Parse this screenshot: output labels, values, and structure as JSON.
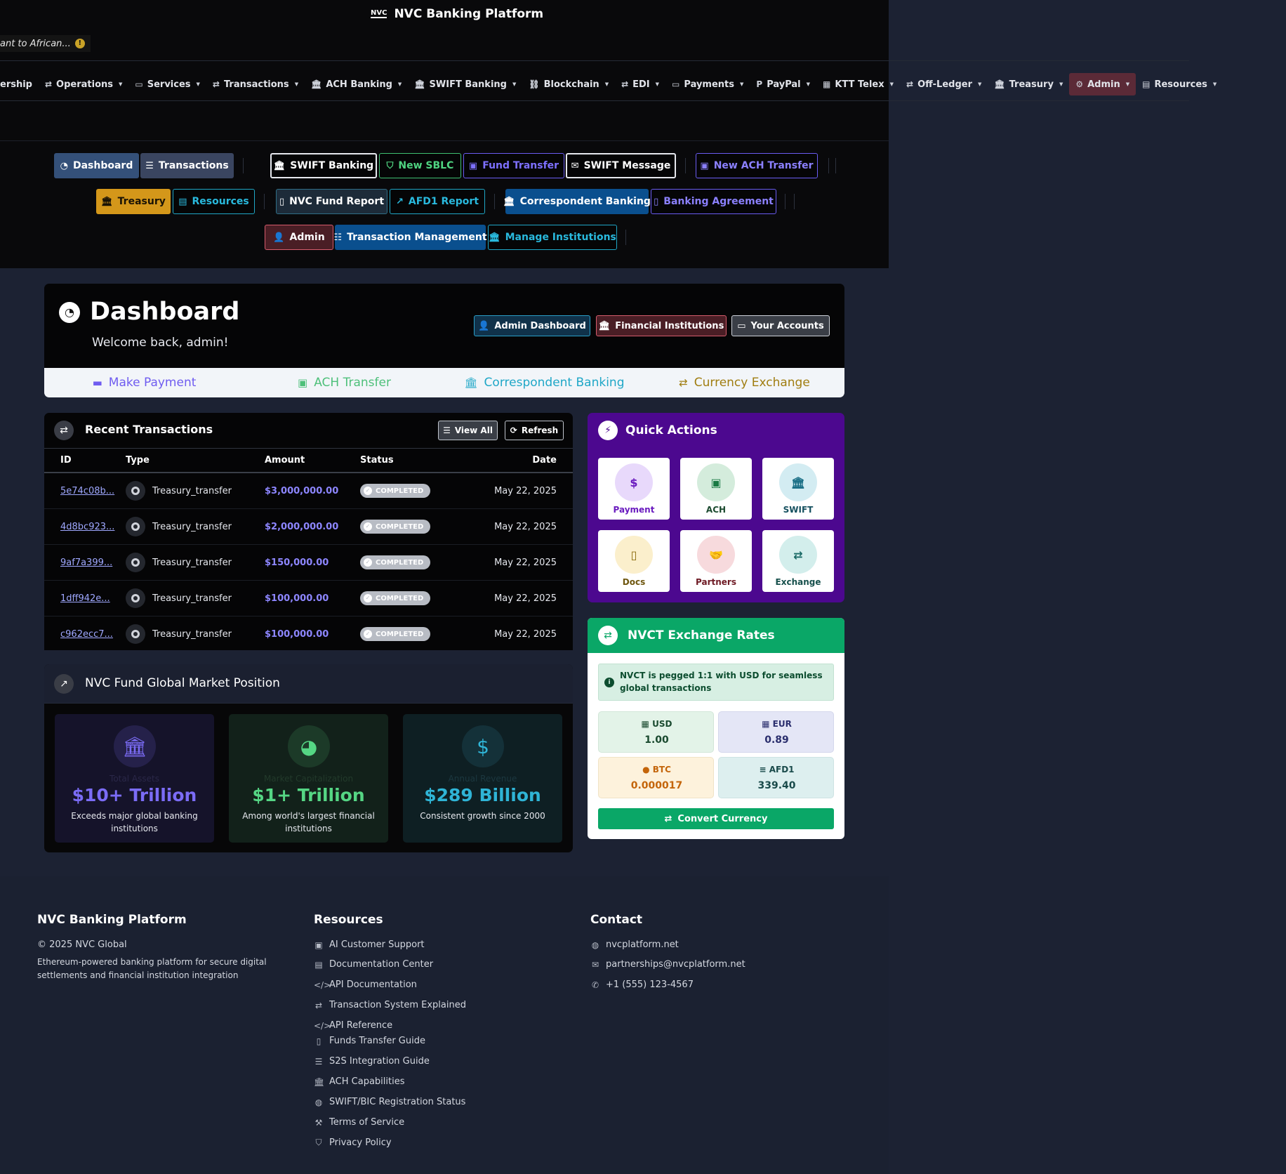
{
  "brand": {
    "logo_text": "NVC",
    "title": "NVC Banking Platform"
  },
  "ticker": {
    "text": "ant to African...",
    "icon": "info-icon"
  },
  "main_nav": [
    {
      "label": "ership",
      "icon": "",
      "caret": false
    },
    {
      "label": "Operations",
      "icon": "exchange-icon",
      "caret": true
    },
    {
      "label": "Services",
      "icon": "card-icon",
      "caret": true
    },
    {
      "label": "Transactions",
      "icon": "exchange-icon",
      "caret": true
    },
    {
      "label": "ACH Banking",
      "icon": "bank-icon",
      "caret": true
    },
    {
      "label": "SWIFT Banking",
      "icon": "bank-icon",
      "caret": true
    },
    {
      "label": "Blockchain",
      "icon": "link-icon",
      "caret": true
    },
    {
      "label": "EDI",
      "icon": "exchange-icon",
      "caret": true
    },
    {
      "label": "Payments",
      "icon": "card-icon",
      "caret": true
    },
    {
      "label": "PayPal",
      "icon": "paypal-icon",
      "caret": true
    },
    {
      "label": "KTT Telex",
      "icon": "building-icon",
      "caret": true
    },
    {
      "label": "Off-Ledger",
      "icon": "exchange-icon",
      "caret": true
    },
    {
      "label": "Treasury",
      "icon": "bank-icon",
      "caret": true
    },
    {
      "label": "Admin",
      "icon": "gear-icon",
      "caret": true,
      "active": true
    },
    {
      "label": "Resources",
      "icon": "book-icon",
      "caret": true
    }
  ],
  "quick_buttons": {
    "dashboard": "Dashboard",
    "transactions": "Transactions",
    "swift_banking": "SWIFT Banking",
    "new_sblc": "New SBLC",
    "fund_transfer": "Fund Transfer",
    "swift_message": "SWIFT Message",
    "new_ach_transfer": "New ACH Transfer",
    "treasury": "Treasury",
    "resources": "Resources",
    "nvc_fund_report": "NVC Fund Report",
    "afd1_report": "AFD1 Report",
    "correspondent_banking": "Correspondent Banking",
    "banking_agreement": "Banking Agreement",
    "admin": "Admin",
    "transaction_management": "Transaction Management",
    "manage_institutions": "Manage Institutions"
  },
  "dashboard": {
    "title": "Dashboard",
    "welcome": "Welcome back, admin!",
    "header_buttons": {
      "admin_dashboard": "Admin Dashboard",
      "financial_institutions": "Financial Institutions",
      "your_accounts": "Your Accounts"
    },
    "tabs": [
      {
        "label": "Make Payment",
        "icon": "card-icon",
        "color": "#6f5cf0"
      },
      {
        "label": "ACH Transfer",
        "icon": "money-icon",
        "color": "#4ec07a"
      },
      {
        "label": "Correspondent Banking",
        "icon": "bank-icon",
        "color": "#1fa7c7"
      },
      {
        "label": "Currency Exchange",
        "icon": "exchange-icon",
        "color": "#a07d10"
      }
    ]
  },
  "recent_transactions": {
    "title": "Recent Transactions",
    "view_all": "View All",
    "refresh": "Refresh",
    "columns": [
      "ID",
      "Type",
      "Amount",
      "Status",
      "Date"
    ],
    "rows": [
      {
        "id": "5e74c08b...",
        "type": "Treasury_transfer",
        "amount": "$3,000,000.00",
        "status": "COMPLETED",
        "date": "May 22, 2025"
      },
      {
        "id": "4d8bc923...",
        "type": "Treasury_transfer",
        "amount": "$2,000,000.00",
        "status": "COMPLETED",
        "date": "May 22, 2025"
      },
      {
        "id": "9af7a399...",
        "type": "Treasury_transfer",
        "amount": "$150,000.00",
        "status": "COMPLETED",
        "date": "May 22, 2025"
      },
      {
        "id": "1dff942e...",
        "type": "Treasury_transfer",
        "amount": "$100,000.00",
        "status": "COMPLETED",
        "date": "May 22, 2025"
      },
      {
        "id": "c962ecc7...",
        "type": "Treasury_transfer",
        "amount": "$100,000.00",
        "status": "COMPLETED",
        "date": "May 22, 2025"
      }
    ]
  },
  "market_position": {
    "title": "NVC Fund Global Market Position",
    "tiles": [
      {
        "label": "Total Assets",
        "value": "$10+ Trillion",
        "desc": "Exceeds major global banking institutions",
        "icon": "bank-icon",
        "color": "#7b6cf6"
      },
      {
        "label": "Market Capitalization",
        "value": "$1+ Trillion",
        "desc": "Among world's largest financial institutions",
        "icon": "pie-chart-icon",
        "color": "#55d684"
      },
      {
        "label": "Annual Revenue",
        "value": "$289 Billion",
        "desc": "Consistent growth since 2000",
        "icon": "hand-dollar-icon",
        "color": "#2fb4d6"
      }
    ]
  },
  "quick_actions": {
    "title": "Quick Actions",
    "items": [
      {
        "label": "Payment",
        "icon": "dollar-icon"
      },
      {
        "label": "ACH",
        "icon": "money-icon"
      },
      {
        "label": "SWIFT",
        "icon": "bank-icon"
      },
      {
        "label": "Docs",
        "icon": "document-icon"
      },
      {
        "label": "Partners",
        "icon": "handshake-icon"
      },
      {
        "label": "Exchange",
        "icon": "exchange-icon"
      }
    ]
  },
  "exchange_rates": {
    "title": "NVCT Exchange Rates",
    "note": "NVCT is pegged 1:1 with USD for seamless global transactions",
    "rates": [
      {
        "code": "USD",
        "value": "1.00"
      },
      {
        "code": "EUR",
        "value": "0.89"
      },
      {
        "code": "BTC",
        "value": "0.000017"
      },
      {
        "code": "AFD1",
        "value": "339.40"
      }
    ],
    "convert_button": "Convert Currency"
  },
  "footer": {
    "col1": {
      "heading": "NVC Banking Platform",
      "copyright": "© 2025 NVC Global",
      "desc": "Ethereum-powered banking platform for secure digital settlements and financial institution integration"
    },
    "col2": {
      "heading": "Resources",
      "links": [
        "AI Customer Support",
        "Documentation Center",
        "API Documentation",
        "Transaction System Explained",
        "API Reference",
        "Funds Transfer Guide",
        "S2S Integration Guide",
        "ACH Capabilities",
        "SWIFT/BIC Registration Status",
        "Terms of Service",
        "Privacy Policy"
      ]
    },
    "col3": {
      "heading": "Contact",
      "links": [
        "nvcplatform.net",
        "partnerships@nvcplatform.net",
        "+1 (555) 123-4567"
      ]
    }
  }
}
